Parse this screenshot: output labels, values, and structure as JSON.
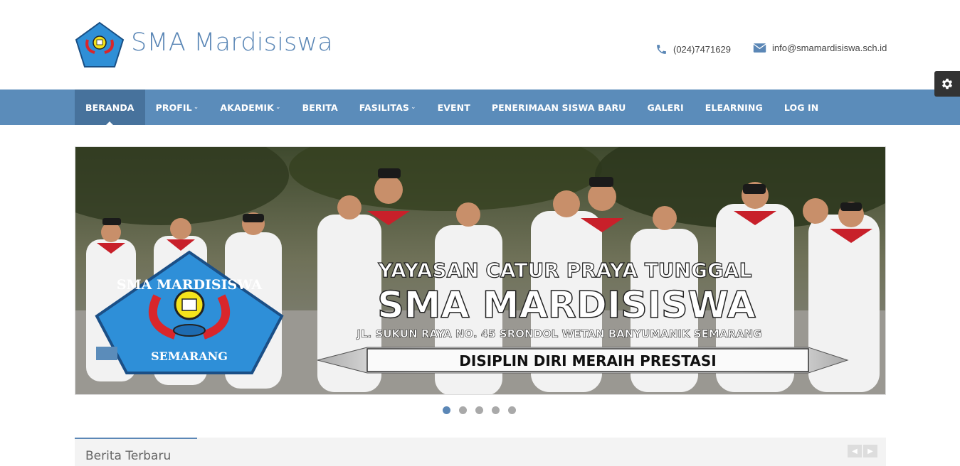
{
  "site": {
    "title": "SMA Mardisiswa"
  },
  "contact": {
    "phone": "(024)7471629",
    "email": "info@smamardisiswa.sch.id"
  },
  "nav": {
    "items": [
      {
        "label": "BERANDA",
        "active": true,
        "dropdown": false
      },
      {
        "label": "PROFIL",
        "dropdown": true
      },
      {
        "label": "AKADEMIK",
        "dropdown": true
      },
      {
        "label": "BERITA",
        "dropdown": false
      },
      {
        "label": "FASILITAS",
        "dropdown": true
      },
      {
        "label": "EVENT",
        "dropdown": false
      },
      {
        "label": "PENERIMAAN SISWA BARU",
        "dropdown": false
      },
      {
        "label": "GALERI",
        "dropdown": false
      },
      {
        "label": "ELEARNING",
        "dropdown": false
      },
      {
        "label": "LOG IN",
        "dropdown": false
      }
    ]
  },
  "slider": {
    "line1": "YAYASAN CATUR PRAYA TUNGGAL",
    "line2": "SMA MARDISISWA",
    "line3": "JL. SUKUN RAYA NO. 45 SRONDOL WETAN BANYUMANIK SEMARANG",
    "banner": "DISIPLIN DIRI MERAIH PRESTASI",
    "logo_top": "SMA MARDISISWA",
    "logo_bottom": "SEMARANG",
    "slide_count": 5,
    "active_slide": 1
  },
  "news": {
    "title": "Berita Terbaru"
  },
  "colors": {
    "primary": "#5b8cba",
    "nav_active": "#47729c",
    "title": "#5b87b6"
  }
}
